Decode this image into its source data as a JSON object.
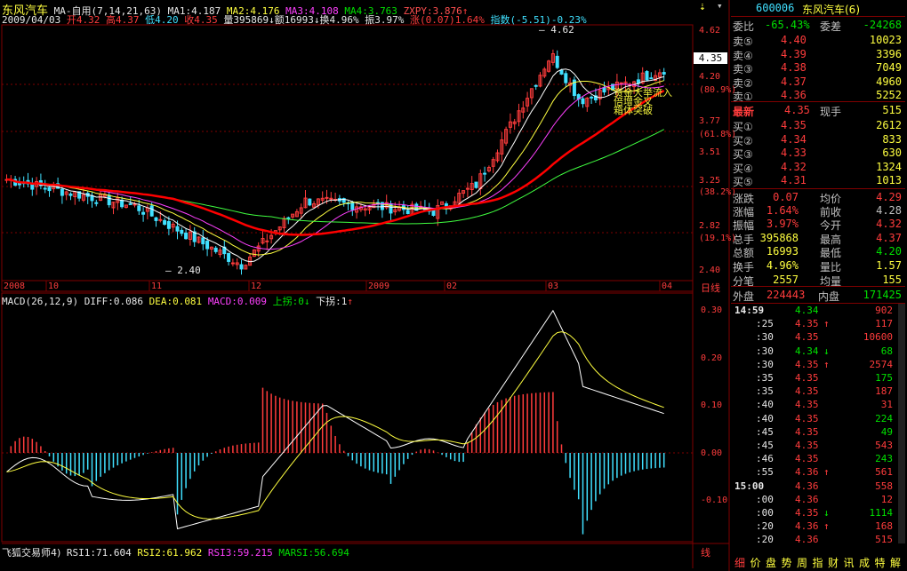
{
  "header": {
    "name": "东风汽车",
    "ma_mode": "MA-自用",
    "ma_params": "(7,14,21,63)",
    "ma1": "MA1:4.187",
    "ma2": "MA2:4.176",
    "ma3": "MA3:4.108",
    "ma4": "MA4:3.763",
    "zxpy": "ZXPY:3.876",
    "zxpy_arrow": "↑",
    "date": "2009/04/03",
    "open": "开4.32",
    "high": "高4.37",
    "low": "低4.20",
    "close": "收4.35",
    "vol": "量395869",
    "amt": "额16993",
    "turn": "换4.96%",
    "amp": "振3.97%",
    "chg": "涨(0.07)1.64%",
    "index": "指数(-5.51)-0.23%",
    "up_arrow": "↑",
    "down_arrow": "↓"
  },
  "price_axis": [
    "4.62",
    "4.20",
    "(80.9%)",
    "3.77",
    "(61.8%)",
    "3.51",
    "3.25",
    "(38.2%)",
    "2.82",
    "(19.1%)",
    "2.40"
  ],
  "current_price_tag": "4.35",
  "annotations": {
    "high": "4.62",
    "low": "2.40",
    "signals": "资金大举流入\n倍增金叉\n箱体突破"
  },
  "time_axis": [
    "2008",
    "10",
    "11",
    "12",
    "2009",
    "02",
    "03",
    "04"
  ],
  "period": "日线",
  "macd": {
    "title": "MACD(26,12,9)",
    "diff": "DIFF:0.086",
    "dea": "DEA:0.081",
    "macd": "MACD:0.009",
    "up": "上拐:0",
    "down": "下拐:1",
    "axis": [
      "0.30",
      "0.20",
      "0.10",
      "0.00",
      "-0.10"
    ]
  },
  "rsi": {
    "title": "飞狐交易师4)",
    "r1": "RSI1:71.604",
    "r2": "RSI2:61.962",
    "r3": "RSI3:59.215",
    "ma": "MARSI:56.694"
  },
  "panel": {
    "code": "600006",
    "name": "东风汽车(6)",
    "weibi_label": "委比",
    "weibi": "-65.43%",
    "weicha_label": "委差",
    "weicha": "-24268",
    "asks": [
      {
        "label": "卖⑤",
        "price": "4.40",
        "vol": "10023"
      },
      {
        "label": "卖④",
        "price": "4.39",
        "vol": "3396"
      },
      {
        "label": "卖③",
        "price": "4.38",
        "vol": "7049"
      },
      {
        "label": "卖②",
        "price": "4.37",
        "vol": "4960"
      },
      {
        "label": "卖①",
        "price": "4.36",
        "vol": "5252"
      }
    ],
    "last_label": "最新",
    "last": "4.35",
    "now_label": "现手",
    "now": "515",
    "bids": [
      {
        "label": "买①",
        "price": "4.35",
        "vol": "2612"
      },
      {
        "label": "买②",
        "price": "4.34",
        "vol": "833"
      },
      {
        "label": "买③",
        "price": "4.33",
        "vol": "630"
      },
      {
        "label": "买④",
        "price": "4.32",
        "vol": "1324"
      },
      {
        "label": "买⑤",
        "price": "4.31",
        "vol": "1013"
      }
    ],
    "stats": [
      {
        "l1": "涨跌",
        "v1": "0.07",
        "l2": "均价",
        "v2": "4.29"
      },
      {
        "l1": "涨幅",
        "v1": "1.64%",
        "l2": "前收",
        "v2": "4.28"
      },
      {
        "l1": "振幅",
        "v1": "3.97%",
        "l2": "今开",
        "v2": "4.32"
      },
      {
        "l1": "总手",
        "v1": "395868",
        "l2": "最高",
        "v2": "4.37"
      },
      {
        "l1": "总额",
        "v1": "16993",
        "l2": "最低",
        "v2": "4.20"
      },
      {
        "l1": "换手",
        "v1": "4.96%",
        "l2": "量比",
        "v2": "1.57"
      },
      {
        "l1": "分笔",
        "v1": "2557",
        "l2": "均量",
        "v2": "155"
      }
    ],
    "outer_label": "外盘",
    "outer": "224443",
    "inner_label": "内盘",
    "inner": "171425",
    "ticks": [
      {
        "t": "14:59",
        "p": "4.34",
        "a": "",
        "v": "902"
      },
      {
        "t": ":25",
        "p": "4.35",
        "a": "↑",
        "v": "117"
      },
      {
        "t": ":30",
        "p": "4.35",
        "a": "",
        "v": "10600"
      },
      {
        "t": ":30",
        "p": "4.34",
        "a": "↓",
        "v": "68"
      },
      {
        "t": ":30",
        "p": "4.35",
        "a": "↑",
        "v": "2574"
      },
      {
        "t": ":35",
        "p": "4.35",
        "a": "",
        "v": "175"
      },
      {
        "t": ":35",
        "p": "4.35",
        "a": "",
        "v": "187"
      },
      {
        "t": ":40",
        "p": "4.35",
        "a": "",
        "v": "31"
      },
      {
        "t": ":40",
        "p": "4.35",
        "a": "",
        "v": "224"
      },
      {
        "t": ":45",
        "p": "4.35",
        "a": "",
        "v": "49"
      },
      {
        "t": ":45",
        "p": "4.35",
        "a": "",
        "v": "543"
      },
      {
        "t": ":46",
        "p": "4.35",
        "a": "",
        "v": "243"
      },
      {
        "t": ":55",
        "p": "4.36",
        "a": "↑",
        "v": "561"
      },
      {
        "t": "15:00",
        "p": "4.36",
        "a": "",
        "v": "558"
      },
      {
        "t": ":00",
        "p": "4.36",
        "a": "",
        "v": "12"
      },
      {
        "t": ":00",
        "p": "4.35",
        "a": "↓",
        "v": "1114"
      },
      {
        "t": ":20",
        "p": "4.36",
        "a": "↑",
        "v": "168"
      },
      {
        "t": ":20",
        "p": "4.36",
        "a": "",
        "v": "515"
      }
    ],
    "bottom_tabs": [
      "细",
      "价",
      "盘",
      "势",
      "周",
      "指",
      "财",
      "讯",
      "成",
      "特",
      "解"
    ]
  },
  "colors": {
    "up": "#ff3c3c",
    "down": "#40e0ff",
    "ma_white": "#ffffff",
    "ma_yellow": "#ffff40",
    "ma_magenta": "#ff40ff",
    "ma_green": "#40ff40",
    "ma_red": "#ff0000",
    "grid": "#800000"
  }
}
